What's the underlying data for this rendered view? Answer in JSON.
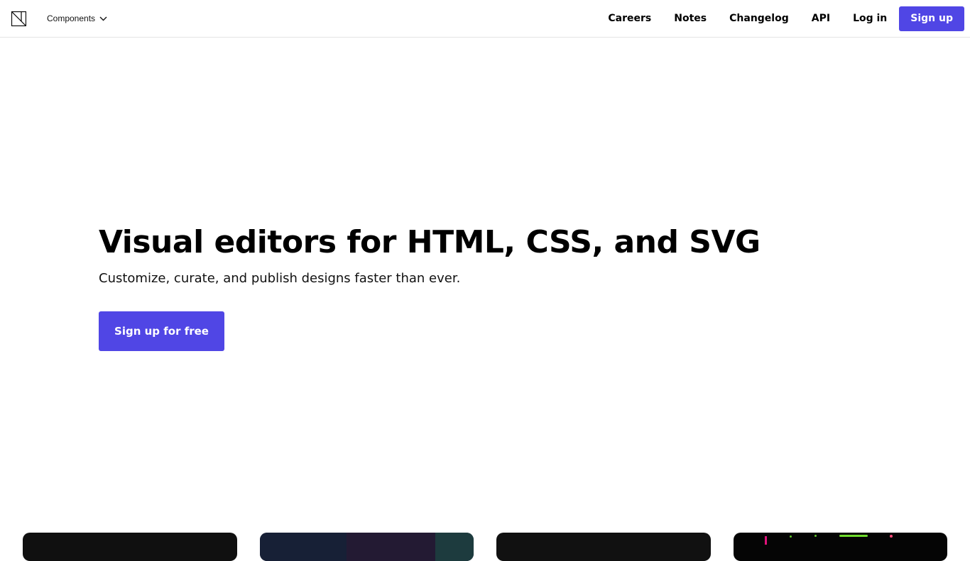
{
  "header": {
    "logo_icon": "logo-mark-icon",
    "components_label": "Components",
    "nav": [
      {
        "label": "Careers"
      },
      {
        "label": "Notes"
      },
      {
        "label": "Changelog"
      },
      {
        "label": "API"
      },
      {
        "label": "Log in"
      }
    ],
    "signup_label": "Sign up"
  },
  "hero": {
    "title": "Visual editors for HTML, CSS, and SVG",
    "subtitle": "Customize, curate, and publish designs faster than ever.",
    "cta_label": "Sign up for free"
  },
  "colors": {
    "accent": "#5046e5",
    "text": "#000000",
    "background": "#ffffff"
  }
}
